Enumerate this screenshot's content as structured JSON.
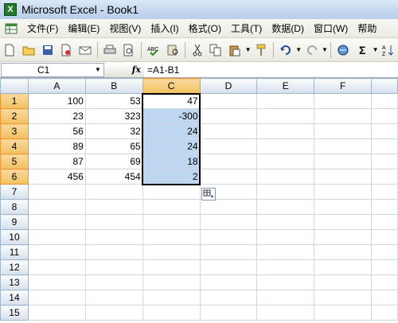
{
  "window": {
    "title": "Microsoft Excel - Book1"
  },
  "menu": {
    "items": [
      "文件(F)",
      "编辑(E)",
      "视图(V)",
      "插入(I)",
      "格式(O)",
      "工具(T)",
      "数据(D)",
      "窗口(W)",
      "帮助"
    ]
  },
  "toolbar": {
    "buttons": [
      "new-icon",
      "open-icon",
      "save-icon",
      "permission-icon",
      "email-icon",
      "print-icon",
      "print-preview-icon",
      "spelling-icon",
      "research-icon",
      "cut-icon",
      "copy-icon",
      "paste-icon",
      "format-painter-icon",
      "undo-icon",
      "redo-icon",
      "hyperlink-icon",
      "autosum-icon",
      "sort-icon"
    ],
    "autosum_label": "Σ"
  },
  "formula_bar": {
    "name_box": "C1",
    "fx_label": "fx",
    "formula": "=A1-B1"
  },
  "sheet": {
    "columns": [
      "A",
      "B",
      "C",
      "D",
      "E",
      "F"
    ],
    "selected_column": "C",
    "rows": [
      {
        "num": "1",
        "A": "100",
        "B": "53",
        "C": "47"
      },
      {
        "num": "2",
        "A": "23",
        "B": "323",
        "C": "-300"
      },
      {
        "num": "3",
        "A": "56",
        "B": "32",
        "C": "24"
      },
      {
        "num": "4",
        "A": "89",
        "B": "65",
        "C": "24"
      },
      {
        "num": "5",
        "A": "87",
        "B": "69",
        "C": "18"
      },
      {
        "num": "6",
        "A": "456",
        "B": "454",
        "C": "2"
      },
      {
        "num": "7"
      },
      {
        "num": "8"
      },
      {
        "num": "9"
      },
      {
        "num": "10"
      },
      {
        "num": "11"
      },
      {
        "num": "12"
      },
      {
        "num": "13"
      },
      {
        "num": "14"
      },
      {
        "num": "15"
      }
    ]
  },
  "colors": {
    "selection_fill": "#bfd6f1",
    "header_highlight": "#f1c15f",
    "grid_line": "#d0d7e5"
  }
}
